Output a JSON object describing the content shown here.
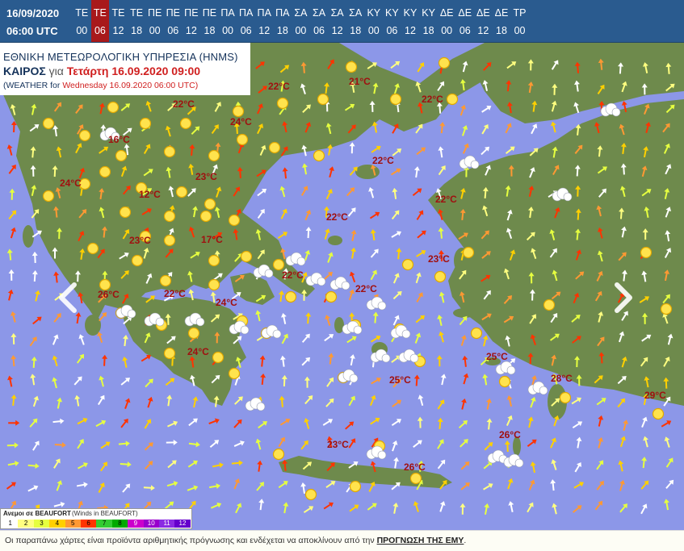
{
  "timebar": {
    "date": "16/09/2020",
    "time": "06:00 UTC",
    "slots": [
      {
        "day": "ΤΕ",
        "hour": "00"
      },
      {
        "day": "ΤΕ",
        "hour": "06"
      },
      {
        "day": "ΤΕ",
        "hour": "12"
      },
      {
        "day": "ΤΕ",
        "hour": "18"
      },
      {
        "day": "ΠΕ",
        "hour": "00"
      },
      {
        "day": "ΠΕ",
        "hour": "06"
      },
      {
        "day": "ΠΕ",
        "hour": "12"
      },
      {
        "day": "ΠΕ",
        "hour": "18"
      },
      {
        "day": "ΠΑ",
        "hour": "00"
      },
      {
        "day": "ΠΑ",
        "hour": "06"
      },
      {
        "day": "ΠΑ",
        "hour": "12"
      },
      {
        "day": "ΠΑ",
        "hour": "18"
      },
      {
        "day": "ΣΑ",
        "hour": "00"
      },
      {
        "day": "ΣΑ",
        "hour": "06"
      },
      {
        "day": "ΣΑ",
        "hour": "12"
      },
      {
        "day": "ΣΑ",
        "hour": "18"
      },
      {
        "day": "ΚΥ",
        "hour": "00"
      },
      {
        "day": "ΚΥ",
        "hour": "06"
      },
      {
        "day": "ΚΥ",
        "hour": "12"
      },
      {
        "day": "ΚΥ",
        "hour": "18"
      },
      {
        "day": "ΔΕ",
        "hour": "00"
      },
      {
        "day": "ΔΕ",
        "hour": "06"
      },
      {
        "day": "ΔΕ",
        "hour": "12"
      },
      {
        "day": "ΔΕ",
        "hour": "18"
      },
      {
        "day": "ΤΡ",
        "hour": "00"
      }
    ],
    "active_index": 1
  },
  "title": {
    "agency": "ΕΘΝΙΚΗ ΜΕΤΕΩΡΟΛΟΓΙΚΗ ΥΠΗΡΕΣΙΑ (HNMS)",
    "weather_label": "ΚΑΙΡΟΣ",
    "for_word": "για",
    "forecast_time": "Τετάρτη 16.09.2020 09:00",
    "english_prefix": "(WEATHER for",
    "english_time": "Wednesday 16.09.2020 06:00 UTC)"
  },
  "colors": {
    "header_bg": "#2a5b8f",
    "active_slot": "#a8191b",
    "sea": "#8c97e8",
    "land": "#6e8a4c",
    "temperature_text": "#a01010"
  },
  "temperatures": [
    "21°C",
    "22°C",
    "22°C",
    "22°C",
    "24°C",
    "16°C",
    "22°C",
    "24°C",
    "23°C",
    "12°C",
    "22°C",
    "22°C",
    "23°C",
    "17°C",
    "23°C",
    "22°C",
    "22°C",
    "26°C",
    "22°C",
    "24°C",
    "24°C",
    "25°C",
    "25°C",
    "28°C",
    "29°C",
    "23°C",
    "26°C",
    "26°C"
  ],
  "legend": {
    "title": "Ανεμοι σε BEAUFORT",
    "subtitle": "(Winds in BEAUFORT)",
    "levels": [
      "1",
      "2",
      "3",
      "4",
      "5",
      "6",
      "7",
      "8",
      "9",
      "10",
      "11",
      "12"
    ],
    "colors": [
      "#ffffff",
      "#ffff80",
      "#e6ff40",
      "#ffd000",
      "#ff9933",
      "#ff3300",
      "#33cc33",
      "#00aa00",
      "#cc00cc",
      "#9900cc",
      "#8a2be2",
      "#6600cc"
    ]
  },
  "footer": {
    "text": "Οι παραπάνω χάρτες είναι προϊόντα αριθμητικής πρόγνωσης και ενδέχεται να αποκλίνουν από την",
    "link": "ΠΡΟΓΝΩΣΗ ΤΗΣ ΕΜΥ",
    "end": "."
  },
  "nav": {
    "prev_icon": "chevron-left-icon",
    "next_icon": "chevron-right-icon"
  }
}
